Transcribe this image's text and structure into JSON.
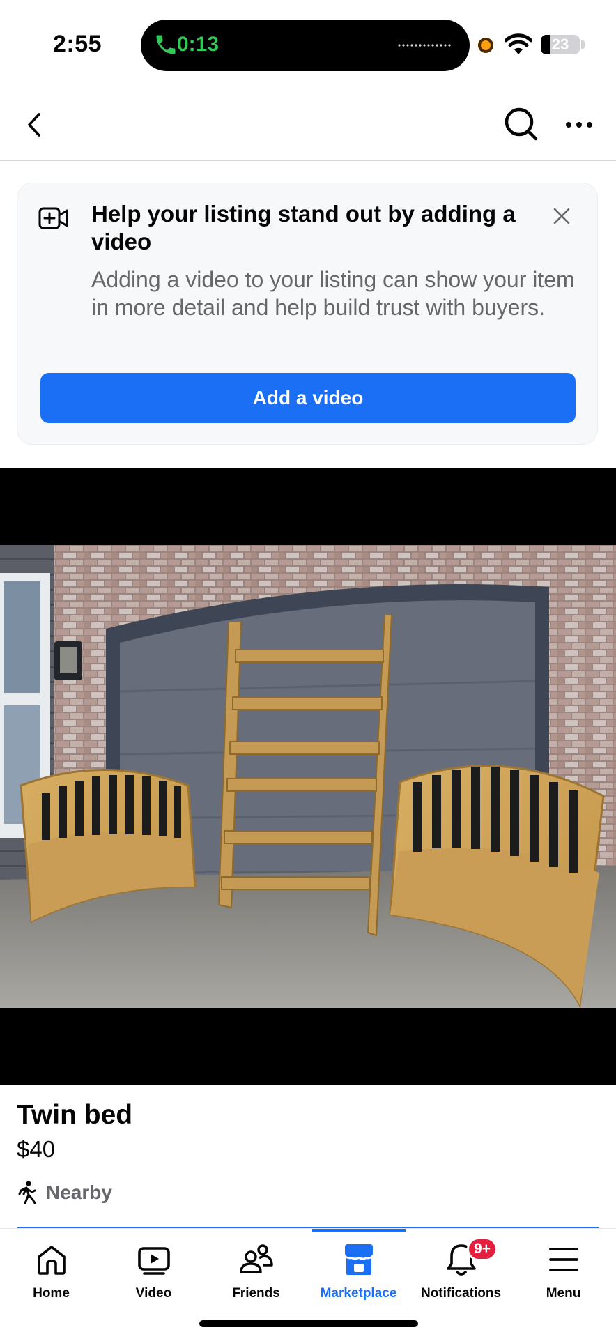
{
  "status_bar": {
    "time": "2:55",
    "call_timer": "0:13",
    "battery_level": "23",
    "battery_fraction": 0.23,
    "call_color": "#34c759",
    "recording_dot_color": "#ff9f0a"
  },
  "top_nav": {
    "back_icon": "chevron-left-icon",
    "search_icon": "search-icon",
    "more_icon": "more-horizontal-icon"
  },
  "promo": {
    "icon": "video-add-icon",
    "title": "Help your listing stand out by adding a video",
    "body": "Adding a video to your listing can show your item in more detail and help build trust with buyers.",
    "button_label": "Add a video",
    "close_icon": "close-icon",
    "button_color": "#1b6ff5"
  },
  "listing": {
    "photo_subject": "listing-photo",
    "title": "Twin bed",
    "price": "$40",
    "distance_label": "Nearby",
    "distance_icon": "walking-person-icon"
  },
  "tab_bar": {
    "tabs": [
      {
        "label": "Home",
        "icon": "home-icon",
        "active": false
      },
      {
        "label": "Video",
        "icon": "video-play-icon",
        "active": false
      },
      {
        "label": "Friends",
        "icon": "friends-icon",
        "active": false
      },
      {
        "label": "Marketplace",
        "icon": "marketplace-store-icon",
        "active": true
      },
      {
        "label": "Notifications",
        "icon": "bell-icon",
        "active": false,
        "badge": "9+"
      },
      {
        "label": "Menu",
        "icon": "hamburger-menu-icon",
        "active": false
      }
    ],
    "accent_color": "#1b6ff5",
    "badge_color": "#e41e3f"
  }
}
